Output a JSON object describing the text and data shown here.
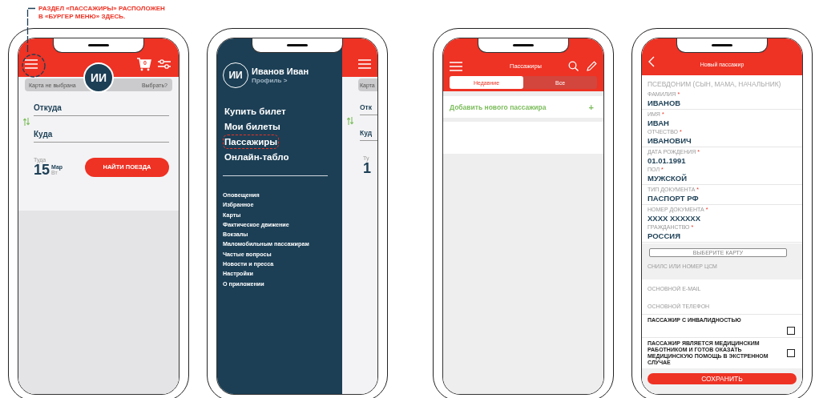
{
  "annotation": {
    "text": "РАЗДЕЛ «ПАССАЖИРЫ» РАСПОЛОЖЕН\nВ «БУРГЕР МЕНЮ» ЗДЕСЬ."
  },
  "search_screen": {
    "cart_count": "0",
    "avatar_initials": "ИИ",
    "card_status": "Карта не выбрана",
    "card_action": "Выбрать?",
    "from_placeholder": "Откуда",
    "to_placeholder": "Куда",
    "direction_label": "Туда",
    "day": "15",
    "month": "Мар",
    "weekday": "Вт",
    "find_button": "НАЙТИ ПОЕЗДА"
  },
  "menu_screen": {
    "avatar_initials": "ИИ",
    "user_name": "Иванов Иван",
    "profile_link": "Профиль >",
    "main_items": [
      {
        "label": "Купить билет",
        "highlighted": false
      },
      {
        "label": "Мои билеты",
        "highlighted": false
      },
      {
        "label": "Пассажиры",
        "highlighted": true
      },
      {
        "label": "Онлайн-табло",
        "highlighted": false
      }
    ],
    "secondary_items": [
      "Оповещения",
      "Избранное",
      "Карты",
      "Фактическое движение",
      "Вокзалы",
      "Маломобильным пассажирам",
      "Частые вопросы",
      "Новости и пресса",
      "Настройки",
      "О приложении"
    ],
    "behind": {
      "card": "Карта",
      "from": "Отк",
      "to": "Куд",
      "direction": "Ту",
      "day": "1"
    }
  },
  "passengers_screen": {
    "title": "Пассажиры",
    "tabs": [
      {
        "label": "Недавние",
        "selected": true
      },
      {
        "label": "Все",
        "selected": false
      }
    ],
    "add_label": "Добавить нового пассажира",
    "add_icon": "+"
  },
  "form_screen": {
    "title": "Новый пассажир",
    "alias_placeholder": "ПСЕВДОНИМ (СЫН, МАМА, НАЧАЛЬНИК)",
    "field_groups": [
      [
        {
          "label": "ФАМИЛИЯ",
          "mark": "*",
          "value": "ИВАНОВ"
        }
      ],
      [
        {
          "label": "ИМЯ",
          "mark": "*",
          "value": "ИВАН"
        },
        {
          "label": "ОТЧЕСТВО",
          "mark": "*",
          "value": "ИВАНОВИЧ"
        }
      ],
      [
        {
          "label": "ДАТА РОЖДЕНИЯ",
          "mark": "*",
          "value": "01.01.1991"
        },
        {
          "label": "ПОЛ",
          "mark": "*",
          "value": "МУЖСКОЙ"
        }
      ],
      [
        {
          "label": "ТИП ДОКУМЕНТА",
          "mark": "*",
          "value": "ПАСПОРТ РФ"
        }
      ],
      [
        {
          "label": "НОМЕР ДОКУМЕНТА",
          "mark": "*",
          "value": "XXXX XXXXXX"
        },
        {
          "label": "ГРАЖДАНСТВО",
          "mark": "*",
          "value": "РОССИЯ"
        }
      ]
    ],
    "card_section": {
      "button": "ВЫБЕРИТЕ КАРТУ",
      "placeholder": "СНИЛС ИЛИ НОМЕР ЦСМ"
    },
    "contact_fields": [
      {
        "placeholder": "ОСНОВНОЙ E-MAIL"
      },
      {
        "placeholder": "ОСНОВНОЙ ТЕЛЕФОН"
      }
    ],
    "checkboxes": [
      {
        "label": "ПАССАЖИР С ИНВАЛИДНОСТЬЮ",
        "checked": false
      },
      {
        "label": "ПАССАЖИР ЯВЛЯЕТСЯ МЕДИЦИНСКИМ РАБОТНИКОМ И ГОТОВ ОКАЗАТЬ МЕДИЦИНСКУЮ ПОМОЩЬ В ЭКСТРЕННОМ СЛУЧАЕ",
        "checked": false
      }
    ],
    "save_button": "СОХРАНИТЬ"
  }
}
